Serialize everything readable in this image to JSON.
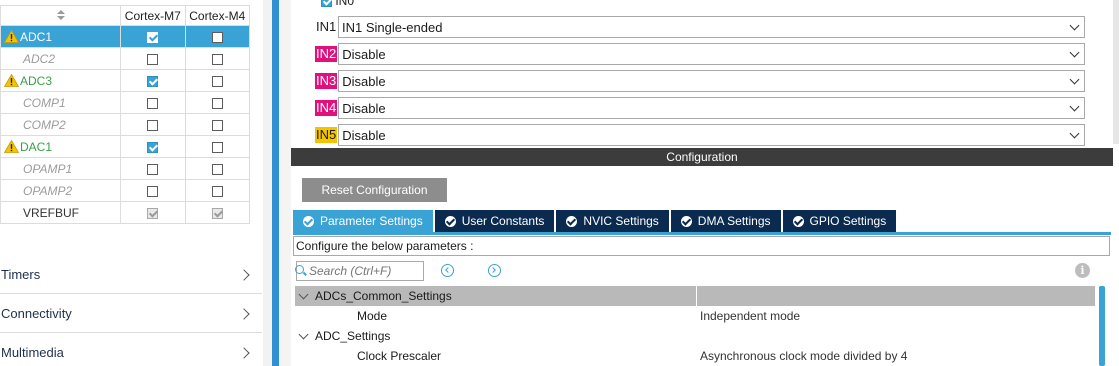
{
  "peripherals": {
    "header": {
      "col1": "Cortex-M7",
      "col2": "Cortex-M4"
    },
    "rows": [
      {
        "name": "ADC1",
        "style": "white",
        "warn": true,
        "selected": true,
        "m7": "on",
        "m4": "off"
      },
      {
        "name": "ADC2",
        "style": "disabled",
        "warn": false,
        "selected": false,
        "m7": "off",
        "m4": "off"
      },
      {
        "name": "ADC3",
        "style": "green",
        "warn": true,
        "selected": false,
        "m7": "on",
        "m4": "off"
      },
      {
        "name": "COMP1",
        "style": "disabled",
        "warn": false,
        "selected": false,
        "m7": "off",
        "m4": "off"
      },
      {
        "name": "COMP2",
        "style": "disabled",
        "warn": false,
        "selected": false,
        "m7": "off",
        "m4": "off"
      },
      {
        "name": "DAC1",
        "style": "green",
        "warn": true,
        "selected": false,
        "m7": "on",
        "m4": "off"
      },
      {
        "name": "OPAMP1",
        "style": "disabled",
        "warn": false,
        "selected": false,
        "m7": "off",
        "m4": "off"
      },
      {
        "name": "OPAMP2",
        "style": "disabled",
        "warn": false,
        "selected": false,
        "m7": "off",
        "m4": "off"
      },
      {
        "name": "VREFBUF",
        "style": "plain",
        "warn": false,
        "selected": false,
        "m7": "dis",
        "m4": "dis"
      }
    ]
  },
  "categories": [
    "Timers",
    "Connectivity",
    "Multimedia"
  ],
  "modes": {
    "top_label": "IN0",
    "rows": [
      {
        "label": "IN1",
        "tag": "none",
        "value": "IN1 Single-ended"
      },
      {
        "label": "IN2",
        "tag": "pink",
        "value": "Disable"
      },
      {
        "label": "IN3",
        "tag": "pink",
        "value": "Disable"
      },
      {
        "label": "IN4",
        "tag": "pink",
        "value": "Disable"
      },
      {
        "label": "IN5",
        "tag": "yellow",
        "value": "Disable"
      }
    ]
  },
  "config": {
    "header": "Configuration",
    "reset_label": "Reset Configuration",
    "tabs": [
      "Parameter Settings",
      "User Constants",
      "NVIC Settings",
      "DMA Settings",
      "GPIO Settings"
    ],
    "description": "Configure the below parameters :",
    "search_placeholder": "Search (Ctrl+F)",
    "params": [
      {
        "kind": "group",
        "key": "ADCs_Common_Settings",
        "value": ""
      },
      {
        "kind": "item",
        "key": "Mode",
        "value": "Independent mode"
      },
      {
        "kind": "group2",
        "key": "ADC_Settings",
        "value": ""
      },
      {
        "kind": "item",
        "key": "Clock Prescaler",
        "value": "Asynchronous clock mode divided by 4"
      }
    ]
  },
  "colors": {
    "accent": "#3aa3d6",
    "tab_dark": "#0b2a4f",
    "pink": "#e0107d",
    "yellow": "#f5c400",
    "green": "#3aa04a"
  }
}
